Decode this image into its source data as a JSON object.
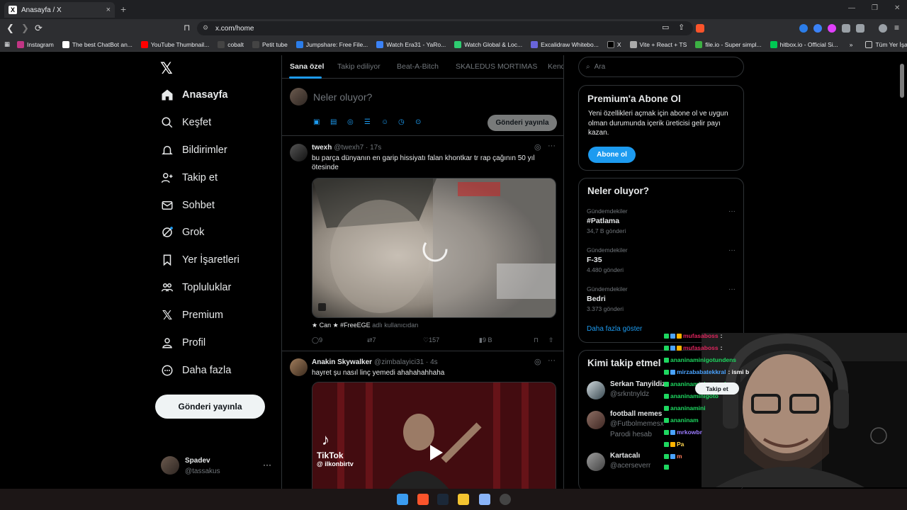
{
  "browser": {
    "tab_title": "Anasayfa / X",
    "tab_icon": "X",
    "tab_close": "×",
    "new_tab": "+",
    "url": "x.com/home",
    "bookmarks": [
      {
        "label": "Instagram",
        "color": "#c13584"
      },
      {
        "label": "The best ChatBot an...",
        "color": "#ffffff"
      },
      {
        "label": "YouTube Thumbnail...",
        "color": "#ff0000"
      },
      {
        "label": "cobalt",
        "color": "#444444"
      },
      {
        "label": "Petit tube",
        "color": "#444444"
      },
      {
        "label": "Jumpshare: Free File...",
        "color": "#2b7de9"
      },
      {
        "label": "Watch Era31 - YaRo...",
        "color": "#3b82f6"
      },
      {
        "label": "Watch Global & Loc...",
        "color": "#2ecc71"
      },
      {
        "label": "Excalidraw Whitebo...",
        "color": "#6965db"
      },
      {
        "label": "X",
        "color": "#000000"
      },
      {
        "label": "Vite + React + TS",
        "color": "#aaaaaa"
      },
      {
        "label": "file.io - Super simpl...",
        "color": "#3cb043"
      },
      {
        "label": "hitbox.io - Official Si...",
        "color": "#00c853"
      }
    ],
    "bookmarks_more": "»",
    "all_bookmarks": "Tüm Yer İşaretleri"
  },
  "nav": {
    "items": [
      {
        "label": "Anasayfa",
        "icon": "home-icon"
      },
      {
        "label": "Keşfet",
        "icon": "search-icon"
      },
      {
        "label": "Bildirimler",
        "icon": "bell-icon"
      },
      {
        "label": "Takip et",
        "icon": "follow-icon"
      },
      {
        "label": "Sohbet",
        "icon": "mail-icon"
      },
      {
        "label": "Grok",
        "icon": "grok-icon"
      },
      {
        "label": "Yer İşaretleri",
        "icon": "bookmark-icon"
      },
      {
        "label": "Topluluklar",
        "icon": "communities-icon"
      },
      {
        "label": "Premium",
        "icon": "x-icon"
      },
      {
        "label": "Profil",
        "icon": "person-icon"
      },
      {
        "label": "Daha fazla",
        "icon": "more-circle-icon"
      }
    ],
    "post_button": "Gönderi yayınla",
    "profile": {
      "name": "Spadev",
      "handle": "@tassakus",
      "more": "···"
    }
  },
  "timeline": {
    "tabs": [
      "Sana özel",
      "Takip ediliyor",
      "Beat-A-Bitch",
      "SKALEDUS MORTIMAS",
      "Kend"
    ],
    "composer_placeholder": "Neler oluyor?",
    "composer_button": "Gönderi yayınla",
    "tweets": [
      {
        "name": "twexh",
        "handle": "@twexh7 · 17s",
        "text": "bu parça dünyanın en garip hissiyatı falan khontkar tr rap çağının 50 yıl ötesinde",
        "attribution": "★ Can ★ #FreeEGE",
        "attribution_suffix": "adlı kullanıcıdan",
        "replies": "9",
        "reposts": "7",
        "likes": "157",
        "views": "9 B"
      },
      {
        "name": "Anakin Skywalker",
        "handle": "@zimbalayici31 · 4s",
        "text": "hayret şu nasıl linç yemedi ahahahahhaha",
        "video_label": "TikTok",
        "video_handle": "@ ilkonbirtv"
      }
    ]
  },
  "right": {
    "search_placeholder": "Ara",
    "premium": {
      "title": "Premium'a Abone Ol",
      "text": "Yeni özellikleri açmak için abone ol ve uygun olman durumunda içerik üreticisi gelir payı kazan.",
      "button": "Abone ol"
    },
    "trends": {
      "title": "Neler oluyor?",
      "items": [
        {
          "category": "Gündemdekiler",
          "name": "#Patlama",
          "count": "34,7 B gönderi"
        },
        {
          "category": "Gündemdekiler",
          "name": "F-35",
          "count": "4.480 gönderi"
        },
        {
          "category": "Gündemdekiler",
          "name": "Bedri",
          "count": "3.373 gönderi"
        }
      ],
      "show_more": "Daha fazla göster"
    },
    "who_to_follow": {
      "title": "Kimi takip etmel",
      "items": [
        {
          "name": "Serkan Tanyildiz",
          "handle": "@srkntnyldz"
        },
        {
          "name": "football memes",
          "handle": "@Futbolmemesx",
          "extra": "Parodi hesab"
        },
        {
          "name": "Kartacalı",
          "handle": "@acerseverr"
        }
      ],
      "follow_button": "Takip et"
    }
  },
  "overlay": {
    "chat": [
      {
        "user": "mufasaboss",
        "msg": ":",
        "color": "#e0245e"
      },
      {
        "user": "mufasaboss",
        "msg": ":",
        "color": "#e0245e"
      },
      {
        "user": "ananinaminigotundens",
        "msg": "",
        "color": "#1ed760"
      },
      {
        "user": "mirzababatekkral",
        "msg": ": ismi b",
        "color": "#4aa3ff"
      },
      {
        "user": "ananinaminigotundens",
        "msg": "",
        "color": "#1ed760"
      },
      {
        "user": "ananinaminigoto",
        "msg": "",
        "color": "#1ed760"
      },
      {
        "user": "ananinamini",
        "msg": "",
        "color": "#1ed760"
      },
      {
        "user": "ananinam",
        "msg": "",
        "color": "#1ed760"
      },
      {
        "user": "mrkowbr",
        "msg": "",
        "color": "#9b7bff"
      },
      {
        "user": "Pa",
        "msg": "",
        "color": "#ffd54f"
      },
      {
        "user": "m",
        "msg": "",
        "color": "#ff7a59"
      }
    ]
  }
}
